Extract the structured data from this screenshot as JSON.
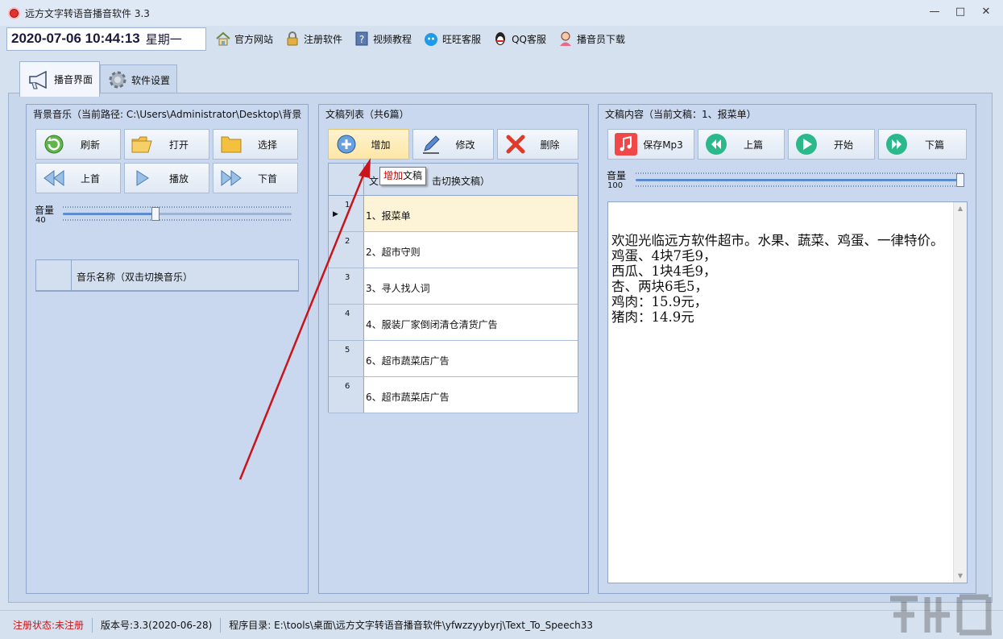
{
  "window": {
    "title": "远方文字转语音播音软件 3.3",
    "min": "—",
    "max": "□",
    "close": "✕"
  },
  "toolbar": {
    "datetime": "2020-07-06 10:44:13",
    "weekday": "星期一",
    "links": [
      "官方网站",
      "注册软件",
      "视频教程",
      "旺旺客服",
      "QQ客服",
      "播音员下载"
    ]
  },
  "tabs": [
    "播音界面",
    "软件设置"
  ],
  "music": {
    "title": "背景音乐（当前路径: C:\\Users\\Administrator\\Desktop\\背景",
    "buttons": [
      "刷新",
      "打开",
      "选择",
      "上首",
      "播放",
      "下首"
    ],
    "volume_label": "音量",
    "volume": "40",
    "volume_fraction": 0.4,
    "list_header": "音乐名称（双击切换音乐）"
  },
  "scripts": {
    "title": "文稿列表（共6篇）",
    "buttons": [
      "增加",
      "修改",
      "删除"
    ],
    "list_header_a": "文",
    "list_header_b": "击切换文稿）",
    "rows": [
      {
        "num": "1",
        "text": "1、报菜单",
        "selected": true
      },
      {
        "num": "2",
        "text": "2、超市守则"
      },
      {
        "num": "3",
        "text": "3、寻人找人词"
      },
      {
        "num": "4",
        "text": "4、服装厂家倒闭清仓清货广告"
      },
      {
        "num": "5",
        "text": "6、超市蔬菜店广告"
      },
      {
        "num": "6",
        "text": "6、超市蔬菜店广告"
      }
    ],
    "tooltip_hl": "增加",
    "tooltip_rest": "文稿"
  },
  "content": {
    "title": "文稿内容（当前文稿：1、报菜单）",
    "buttons": [
      "保存Mp3",
      "上篇",
      "开始",
      "下篇"
    ],
    "volume_label": "音量",
    "volume": "100",
    "volume_fraction": 1.0,
    "text": "欢迎光临远方软件超市。水果、蔬菜、鸡蛋、一律特价。\n鸡蛋、4块7毛9，\n西瓜、1块4毛9，\n杏、两块6毛5，\n鸡肉：15.9元，\n猪肉：14.9元"
  },
  "status": {
    "reg": "注册状态:未注册",
    "version": "版本号:3.3(2020-06-28)",
    "path": "程序目录: E:\\tools\\桌面\\远方文字转语音播音软件\\yfwzzyybyrj\\Text_To_Speech33"
  },
  "colors": {
    "accent_red": "#d41010",
    "highlight": "#fdf3d6",
    "panel": "#c9d8ee"
  }
}
